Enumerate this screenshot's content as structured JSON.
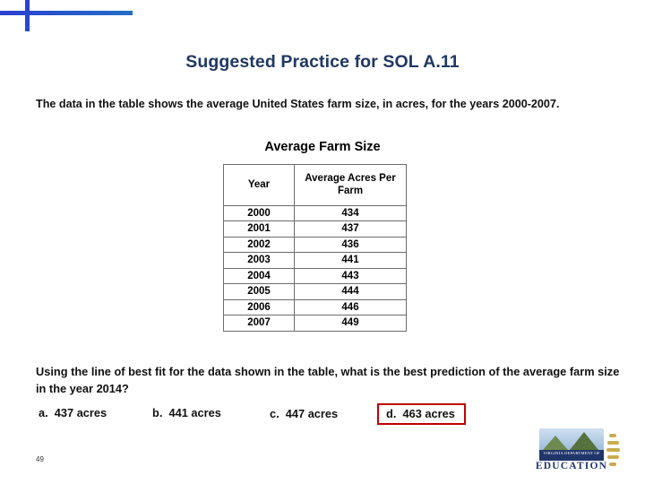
{
  "decor": {
    "gradient_start": "#2b3fd0",
    "gradient_end": "#0fa83f"
  },
  "slide": {
    "title": "Suggested Practice for SOL A.11",
    "intro": "The data in the table shows the average United States farm size, in acres, for the years 2000-2007.",
    "table_caption": "Average Farm Size",
    "question": "Using the line of best fit for the data shown in the table, what is the best prediction of the average farm size in the year 2014?",
    "page_number": "49"
  },
  "table": {
    "headers": [
      "Year",
      "Average Acres Per Farm"
    ],
    "rows": [
      [
        "2000",
        "434"
      ],
      [
        "2001",
        "437"
      ],
      [
        "2002",
        "436"
      ],
      [
        "2003",
        "441"
      ],
      [
        "2004",
        "443"
      ],
      [
        "2005",
        "444"
      ],
      [
        "2006",
        "446"
      ],
      [
        "2007",
        "449"
      ]
    ]
  },
  "choices": {
    "a": "a.  437 acres",
    "b": "b.  441 acres",
    "c": "c.  447 acres",
    "d": "d.  463 acres",
    "highlight_color": "#c00000"
  },
  "logo": {
    "seal_text": "VIRGINIA DEPARTMENT OF",
    "wordmark": "EDUCATION"
  }
}
